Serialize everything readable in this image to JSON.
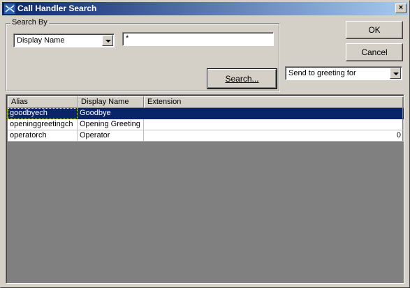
{
  "window": {
    "title": "Call Handler Search",
    "close_label": "×"
  },
  "search": {
    "group_label": "Search By",
    "field_value": "Display Name",
    "query_value": "*",
    "search_button": "Search..."
  },
  "buttons": {
    "ok": "OK",
    "cancel": "Cancel"
  },
  "send_to": {
    "value": "Send to greeting for"
  },
  "table": {
    "columns": [
      "Alias",
      "Display Name",
      "Extension"
    ],
    "rows": [
      {
        "alias": "goodbyech",
        "display_name": "Goodbye",
        "extension": ""
      },
      {
        "alias": "openinggreetingch",
        "display_name": "Opening Greeting",
        "extension": ""
      },
      {
        "alias": "operatorch",
        "display_name": "Operator",
        "extension": "0"
      }
    ]
  },
  "colors": {
    "title_start": "#0a246a",
    "title_end": "#a6caf0",
    "selection": "#0a246a",
    "face": "#d4d0c8"
  }
}
